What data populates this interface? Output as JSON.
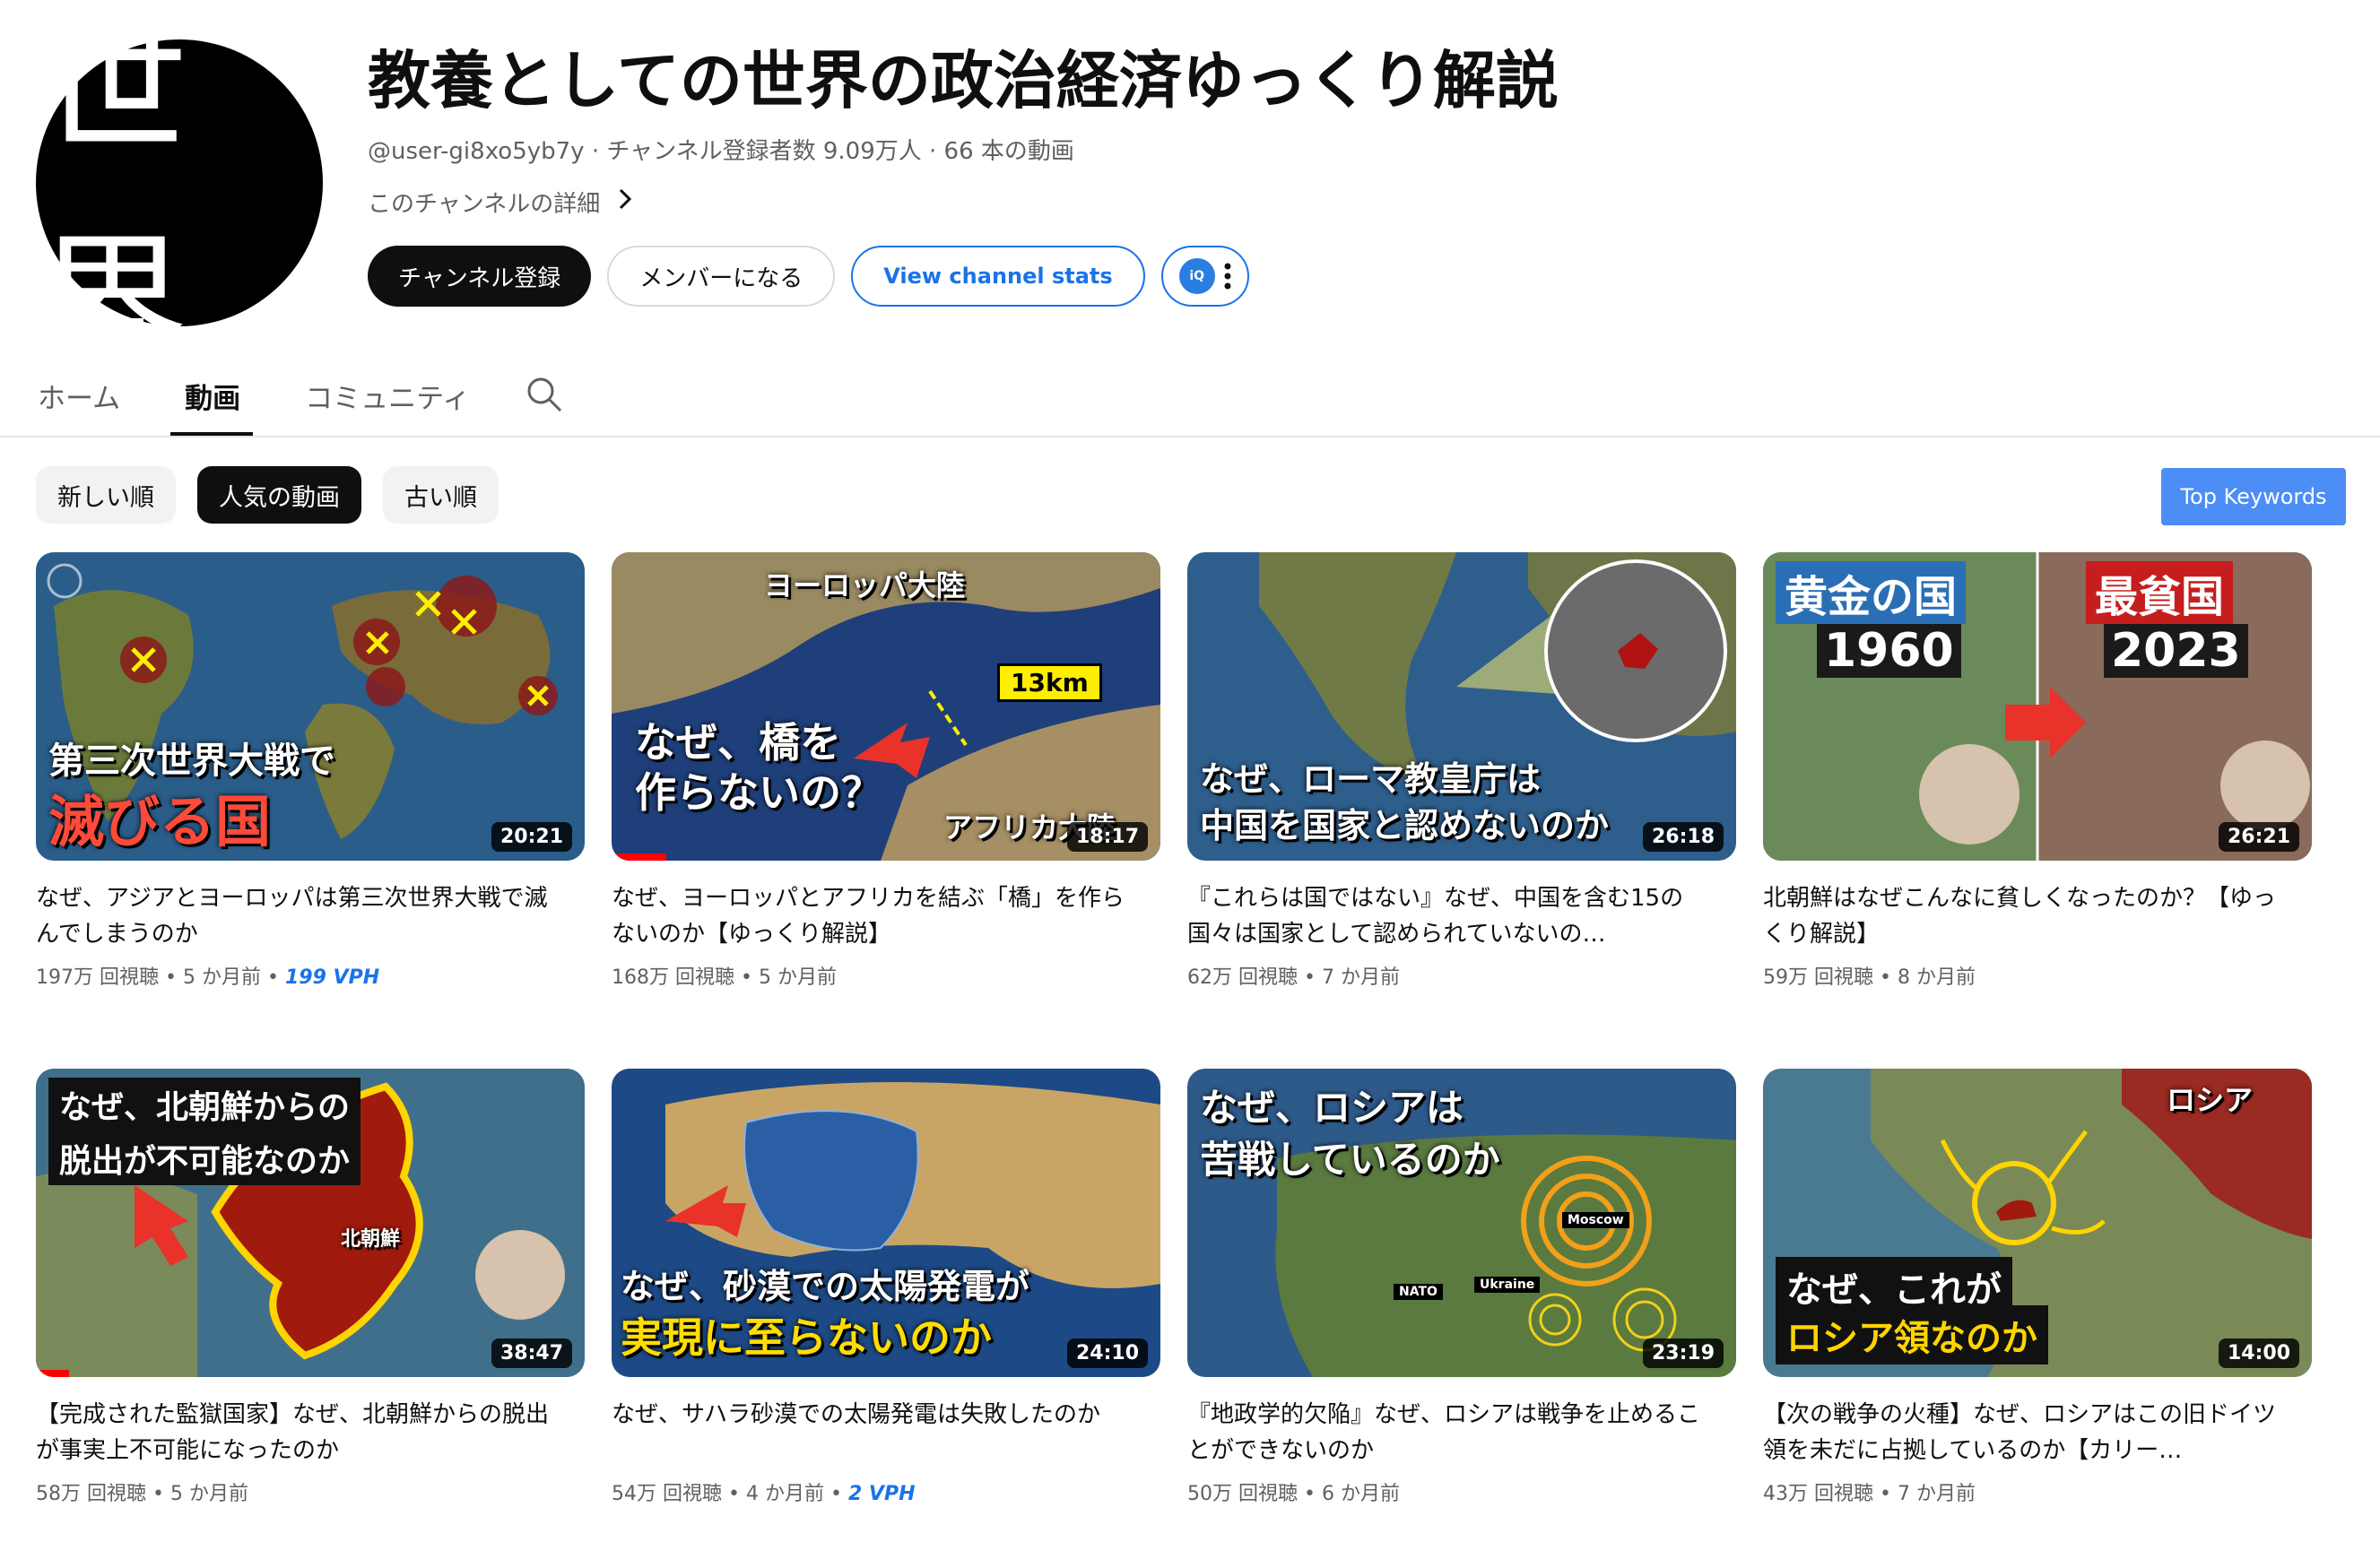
{
  "channel": {
    "avatar_text": "世界",
    "title": "教養としての世界の政治経済ゆっくり解説",
    "handle": "@user-gi8xo5yb7y",
    "subscribers": "チャンネル登録者数 9.09万人",
    "video_count": "66 本の動画",
    "more_link": "このチャンネルの詳細",
    "subscribe_label": "チャンネル登録",
    "member_label": "メンバーになる",
    "stats_label": "View channel stats",
    "ext_logo": "iQ"
  },
  "tabs": [
    {
      "label": "ホーム"
    },
    {
      "label": "動画"
    },
    {
      "label": "コミュニティ"
    }
  ],
  "chips": [
    {
      "label": "新しい順"
    },
    {
      "label": "人気の動画"
    },
    {
      "label": "古い順"
    }
  ],
  "top_keywords": "Top Keywords",
  "videos": [
    {
      "title": "なぜ、アジアとヨーロッパは第三次世界大戦で滅んでしまうのか",
      "views": "197万 回視聴",
      "age": "5 か月前",
      "vph": "199 VPH",
      "duration": "20:21",
      "thumb_line1": "第三次世界大戦で",
      "thumb_line2": "滅びる国",
      "progress": 0
    },
    {
      "title": "なぜ、ヨーロッパとアフリカを結ぶ「橋」を作らないのか【ゆっくり解説】",
      "views": "168万 回視聴",
      "age": "5 か月前",
      "vph": "",
      "duration": "18:17",
      "thumb_line1": "なぜ、橋を",
      "thumb_line2": "作らないの？",
      "thumb_top": "ヨーロッパ大陸",
      "thumb_label": "13km",
      "thumb_bottom": "アフリカ大陸",
      "progress": 0.1
    },
    {
      "title": "『これらは国ではない』なぜ、中国を含む15の国々は国家として認められていないの…",
      "views": "62万 回視聴",
      "age": "7 か月前",
      "vph": "",
      "duration": "26:18",
      "thumb_line1": "なぜ、ローマ教皇庁は",
      "thumb_line2": "中国を国家と認めないのか",
      "progress": 0
    },
    {
      "title": "北朝鮮はなぜこんなに貧しくなったのか？【ゆっくり解説】",
      "views": "59万 回視聴",
      "age": "8 か月前",
      "vph": "",
      "duration": "26:21",
      "thumb_left_top": "黄金の国",
      "thumb_left_year": "1960",
      "thumb_right_top": "最貧国",
      "thumb_right_year": "2023",
      "progress": 0
    },
    {
      "title": "【完成された監獄国家】なぜ、北朝鮮からの脱出が事実上不可能になったのか",
      "views": "58万 回視聴",
      "age": "5 か月前",
      "vph": "",
      "duration": "38:47",
      "thumb_line1": "なぜ、北朝鮮からの",
      "thumb_line2": "脱出が不可能なのか",
      "thumb_label": "北朝鮮",
      "progress": 0.06
    },
    {
      "title": "なぜ、サハラ砂漠での太陽発電は失敗したのか",
      "views": "54万 回視聴",
      "age": "4 か月前",
      "vph": "2 VPH",
      "duration": "24:10",
      "thumb_line1": "なぜ、砂漠での太陽発電が",
      "thumb_line2": "実現に至らないのか",
      "progress": 0
    },
    {
      "title": "『地政学的欠陥』なぜ、ロシアは戦争を止めることができないのか",
      "views": "50万 回視聴",
      "age": "6 か月前",
      "vph": "",
      "duration": "23:19",
      "thumb_line1": "なぜ、ロシアは",
      "thumb_line2": "苦戦しているのか",
      "thumb_tag1": "Moscow",
      "thumb_tag2": "NATO",
      "thumb_tag3": "Ukraine",
      "progress": 0
    },
    {
      "title": "【次の戦争の火種】なぜ、ロシアはこの旧ドイツ領を未だに占拠しているのか【カリー…",
      "views": "43万 回視聴",
      "age": "7 か月前",
      "vph": "",
      "duration": "14:00",
      "thumb_line1": "なぜ、これが",
      "thumb_line2": "ロシア領なのか",
      "thumb_label": "ロシア",
      "progress": 0
    }
  ],
  "colors": {
    "accent_blue": "#1a73e8",
    "progress_red": "#ff0000"
  }
}
